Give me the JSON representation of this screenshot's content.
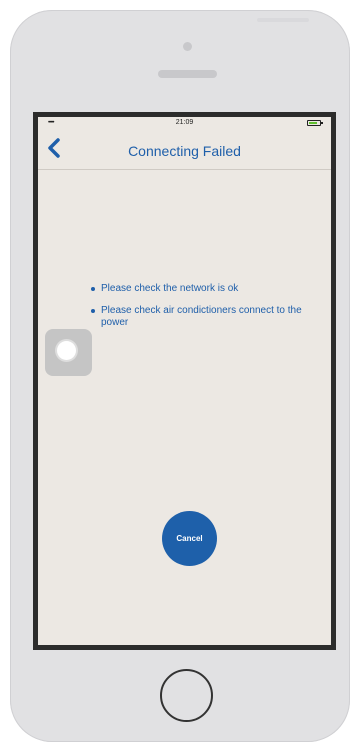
{
  "status_bar": {
    "signal": "•••••",
    "time": "21:09"
  },
  "nav": {
    "title": "Connecting Failed",
    "back_icon": "chevron-left-icon"
  },
  "tips": [
    "Please check the network is ok",
    "Please check air condictioners connect to the power"
  ],
  "actions": {
    "cancel_label": "Cancel"
  },
  "colors": {
    "accent": "#1f5faa",
    "screen_bg": "#ece8e3",
    "battery": "#5fbf2e"
  }
}
